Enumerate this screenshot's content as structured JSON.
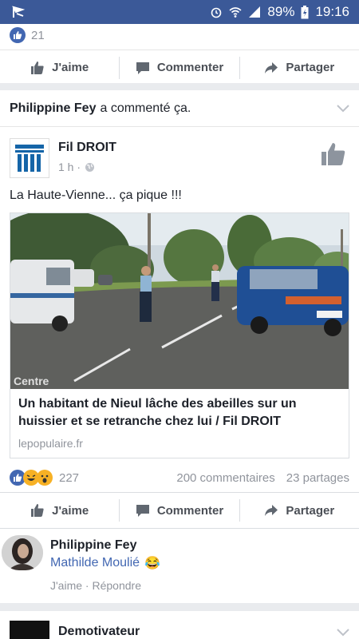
{
  "status_bar": {
    "battery": "89%",
    "time": "19:16"
  },
  "previous_post": {
    "like_count": "21"
  },
  "actions": {
    "like": "J'aime",
    "comment": "Commenter",
    "share": "Partager"
  },
  "notice": {
    "user": "Philippine Fey",
    "text": "a commenté ça."
  },
  "post": {
    "page_name": "Fil DROIT",
    "time": "1 h ·",
    "text": "La Haute-Vienne... ça pique !!!",
    "image_watermark": "Centre",
    "link_title": "Un habitant de Nieul lâche des abeilles sur un huissier et se retranche chez lui / Fil DROIT",
    "link_domain": "lepopulaire.fr",
    "reaction_count": "227",
    "comments_count": "200 commentaires",
    "shares_count": "23 partages"
  },
  "comment": {
    "author": "Philippine Fey",
    "text": "Mathilde Moulié",
    "emoji": "😂",
    "like": "J'aime",
    "reply": "Répondre",
    "separator": " · "
  },
  "next_post": {
    "page_name": "Demotivateur"
  },
  "colors": {
    "brand": "#3b5998",
    "link": "#4267b2",
    "muted": "#90949c"
  }
}
